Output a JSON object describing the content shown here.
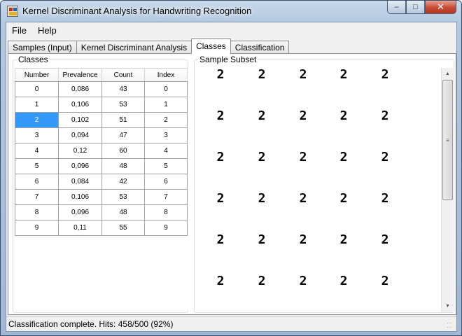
{
  "window": {
    "title": "Kernel Discriminant Analysis for Handwriting Recognition",
    "minimize_glyph": "–",
    "maximize_glyph": "□",
    "close_glyph": "✕"
  },
  "menu": [
    "File",
    "Help"
  ],
  "tabs": [
    "Samples (Input)",
    "Kernel Discriminant Analysis",
    "Classes",
    "Classification"
  ],
  "active_tab": "Classes",
  "classes_group": {
    "title": "Classes",
    "columns": [
      "Number",
      "Prevalence",
      "Count",
      "Index"
    ],
    "rows": [
      [
        "0",
        "0,086",
        "43",
        "0"
      ],
      [
        "1",
        "0,106",
        "53",
        "1"
      ],
      [
        "2",
        "0,102",
        "51",
        "2"
      ],
      [
        "3",
        "0,094",
        "47",
        "3"
      ],
      [
        "4",
        "0,12",
        "60",
        "4"
      ],
      [
        "5",
        "0,096",
        "48",
        "5"
      ],
      [
        "6",
        "0,084",
        "42",
        "6"
      ],
      [
        "7",
        "0,106",
        "53",
        "7"
      ],
      [
        "8",
        "0,096",
        "48",
        "8"
      ],
      [
        "9",
        "0,11",
        "55",
        "9"
      ]
    ],
    "selected_row": 2
  },
  "samples_group": {
    "title": "Sample Subset",
    "digit": "2",
    "rows": 6,
    "cols": 5
  },
  "status": {
    "text": "Classification complete. Hits: 458/500 (92%)"
  }
}
